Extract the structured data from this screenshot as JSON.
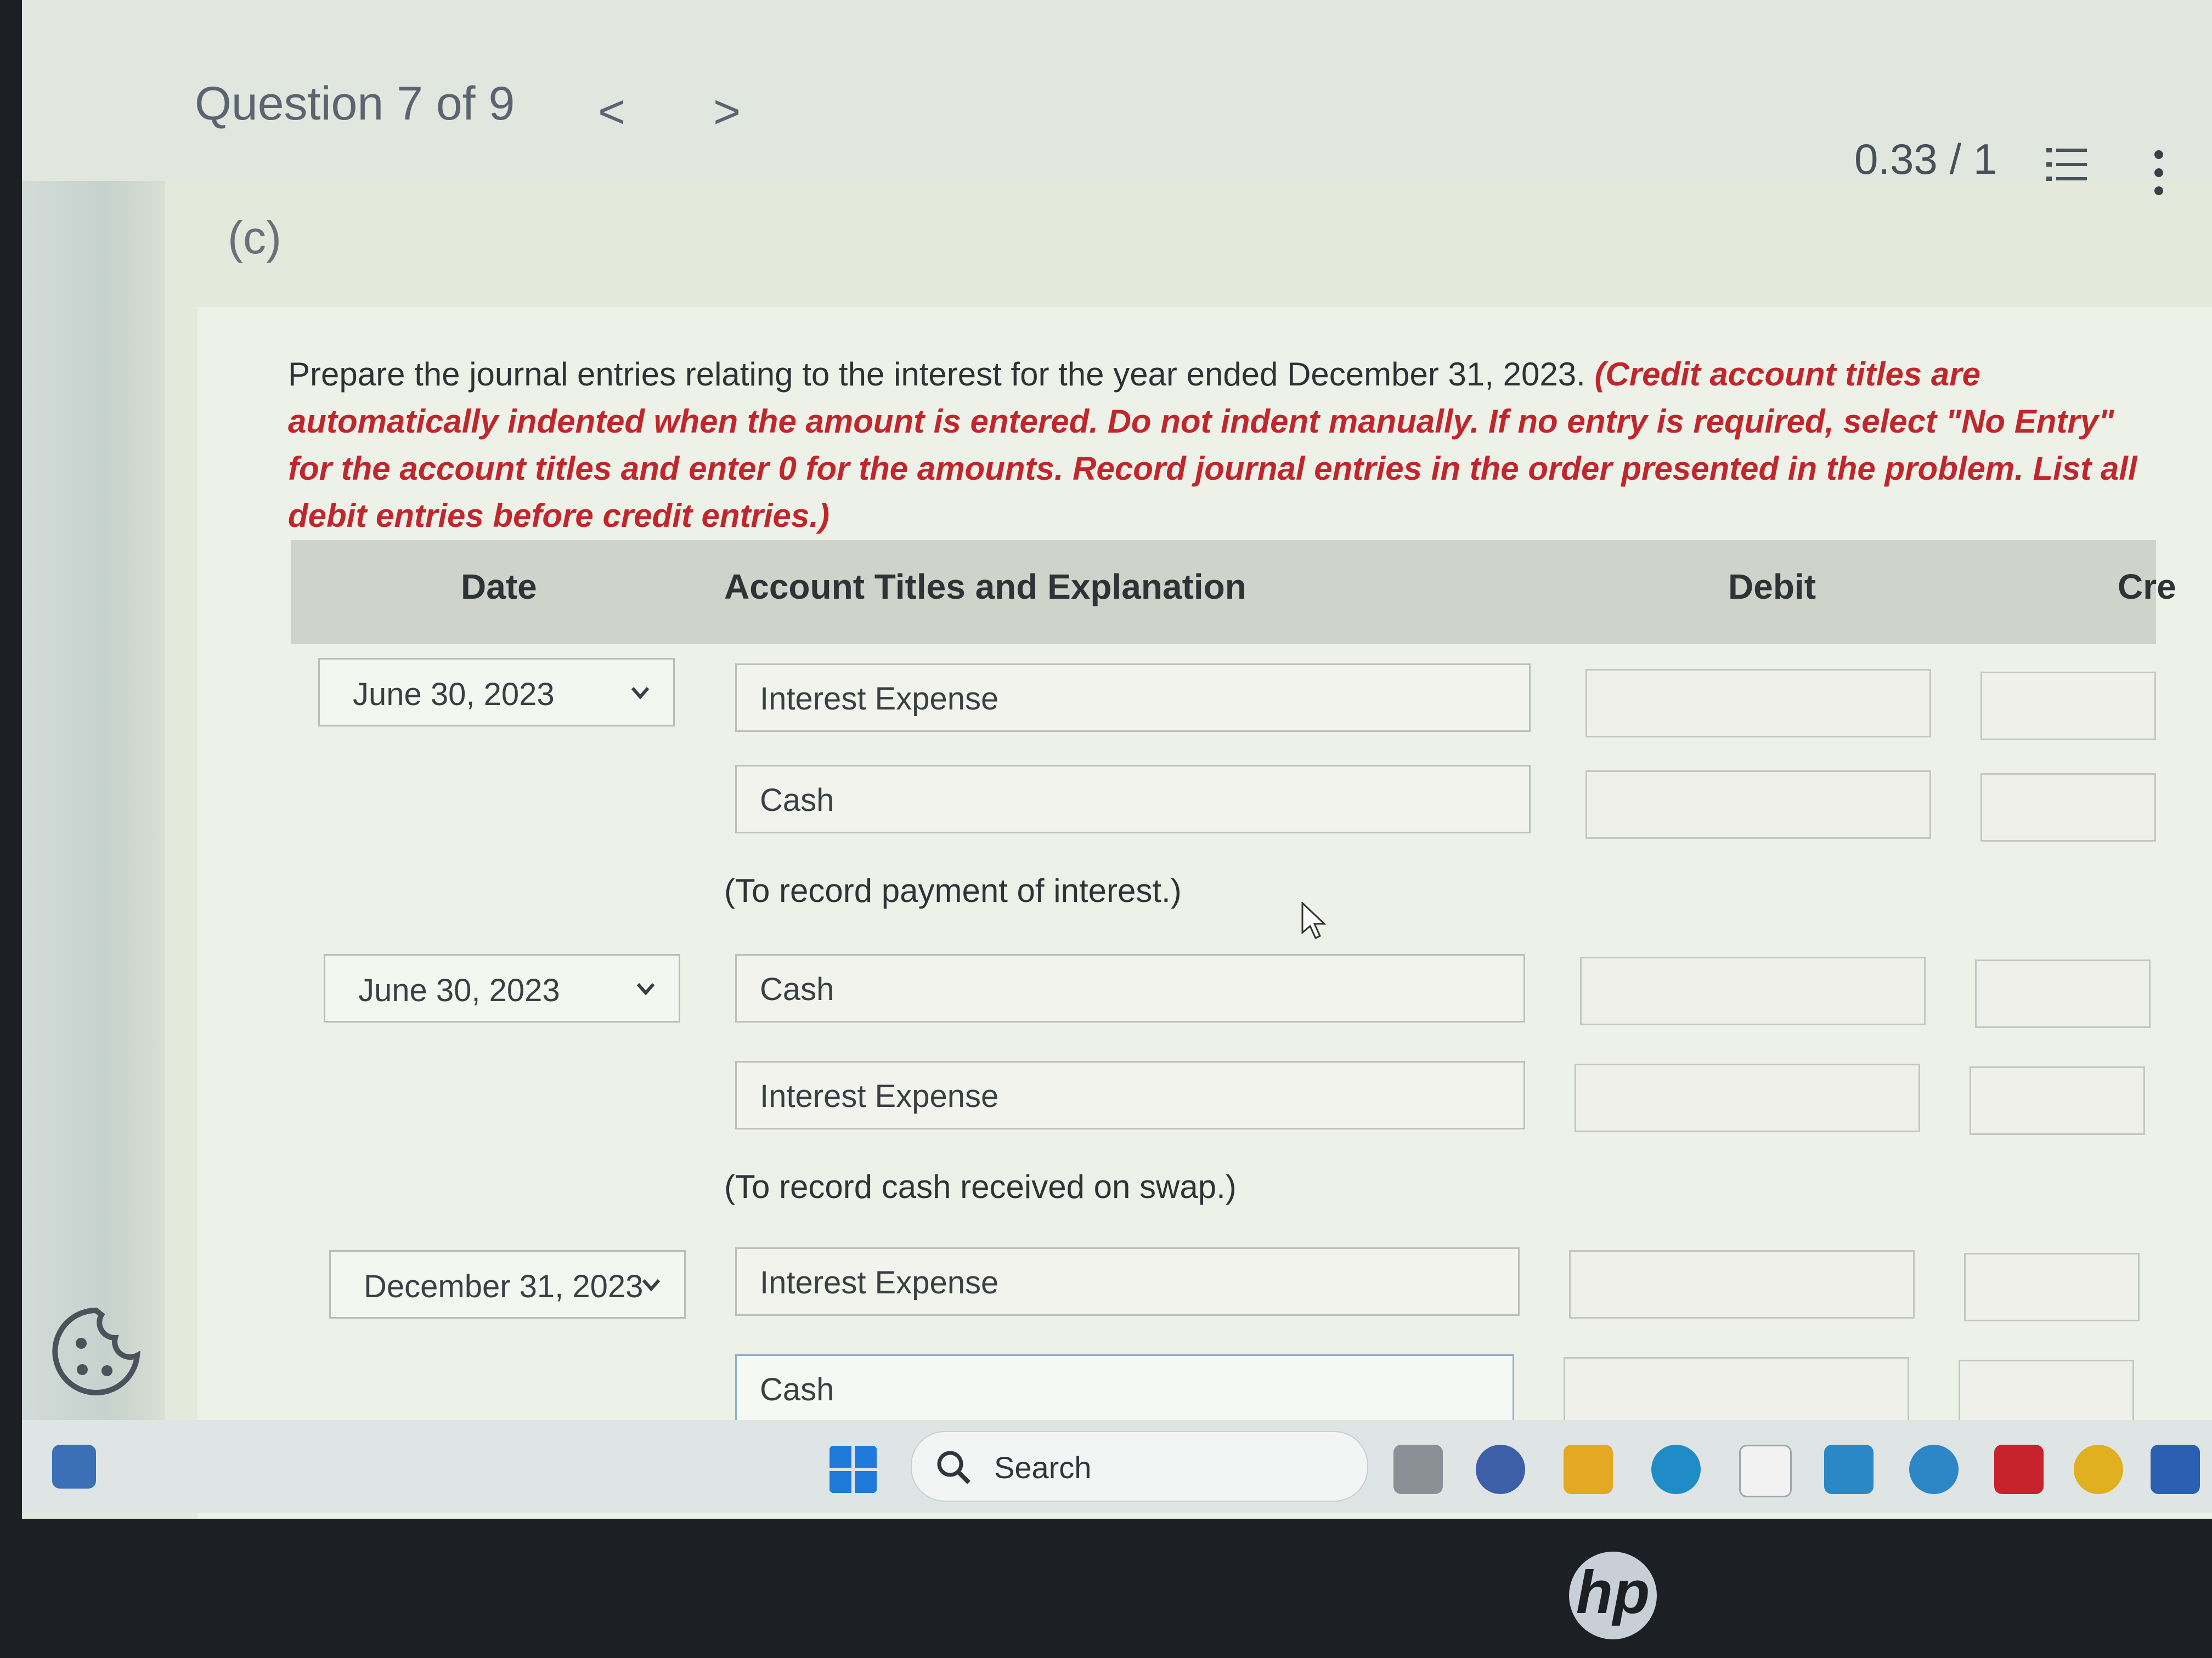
{
  "header": {
    "question_label": "Question 7 of 9",
    "prev_glyph": "<",
    "next_glyph": ">",
    "score": "0.33 / 1"
  },
  "part_label": "(c)",
  "instructions": {
    "main": "Prepare the journal entries relating to the interest for the year ended December 31, 2023. ",
    "note": "(Credit account titles are automatically indented when the amount is entered. Do not indent manually. If no entry is required, select \"No Entry\" for the account titles and enter 0 for the amounts. Record journal entries in the order presented in the problem. List all debit entries before credit entries.)"
  },
  "table": {
    "headers": {
      "date": "Date",
      "account": "Account Titles and Explanation",
      "debit": "Debit",
      "credit": "Cre"
    },
    "entries": [
      {
        "date": "June 30, 2023",
        "lines": [
          {
            "account": "Interest Expense",
            "debit": "",
            "credit": ""
          },
          {
            "account": "Cash",
            "debit": "",
            "credit": ""
          }
        ],
        "memo": "(To record payment of interest.)"
      },
      {
        "date": "June 30, 2023",
        "lines": [
          {
            "account": "Cash",
            "debit": "",
            "credit": ""
          },
          {
            "account": "Interest Expense",
            "debit": "",
            "credit": ""
          }
        ],
        "memo": "(To record cash received on swap.)"
      },
      {
        "date": "December 31, 2023",
        "lines": [
          {
            "account": "Interest Expense",
            "debit": "",
            "credit": ""
          },
          {
            "account": "Cash",
            "debit": "",
            "credit": ""
          }
        ]
      }
    ]
  },
  "taskbar": {
    "search_label": "Search"
  },
  "colors": {
    "accent_red": "#c0272d",
    "header_bg": "#cfd3c9"
  },
  "hp_logo": "hp"
}
